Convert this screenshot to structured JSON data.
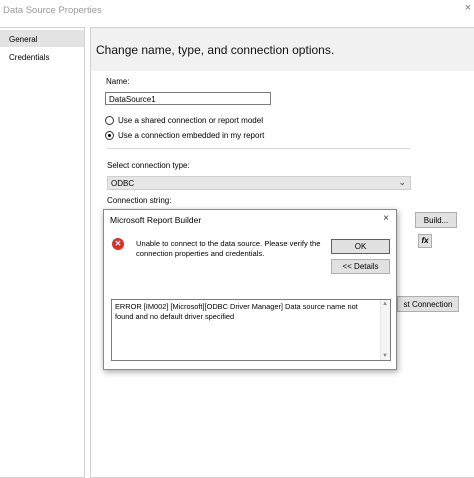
{
  "window": {
    "title": "Data Source Properties",
    "close_glyph": "×"
  },
  "sidebar": {
    "items": [
      {
        "label": "General"
      },
      {
        "label": "Credentials"
      }
    ]
  },
  "main": {
    "header": "Change name, type, and connection options.",
    "name_label": "Name:",
    "name_value": "DataSource1",
    "radio_shared": "Use a shared connection or report model",
    "radio_embedded": "Use a connection embedded in my report",
    "connection_type_label": "Select connection type:",
    "connection_type_value": "ODBC",
    "connection_string_label": "Connection string:",
    "build_button": "Build...",
    "fx_button": "fx",
    "test_connection_button": "st Connection"
  },
  "dialog": {
    "title": "Microsoft Report Builder",
    "close_glyph": "×",
    "message": "Unable to connect to the data source. Please verify the connection properties and credentials.",
    "ok_button": "OK",
    "details_button": "<< Details",
    "error_text": "ERROR [IM002] [Microsoft][ODBC Driver Manager] Data source name not found and no default driver specified",
    "error_icon_glyph": "✕"
  }
}
